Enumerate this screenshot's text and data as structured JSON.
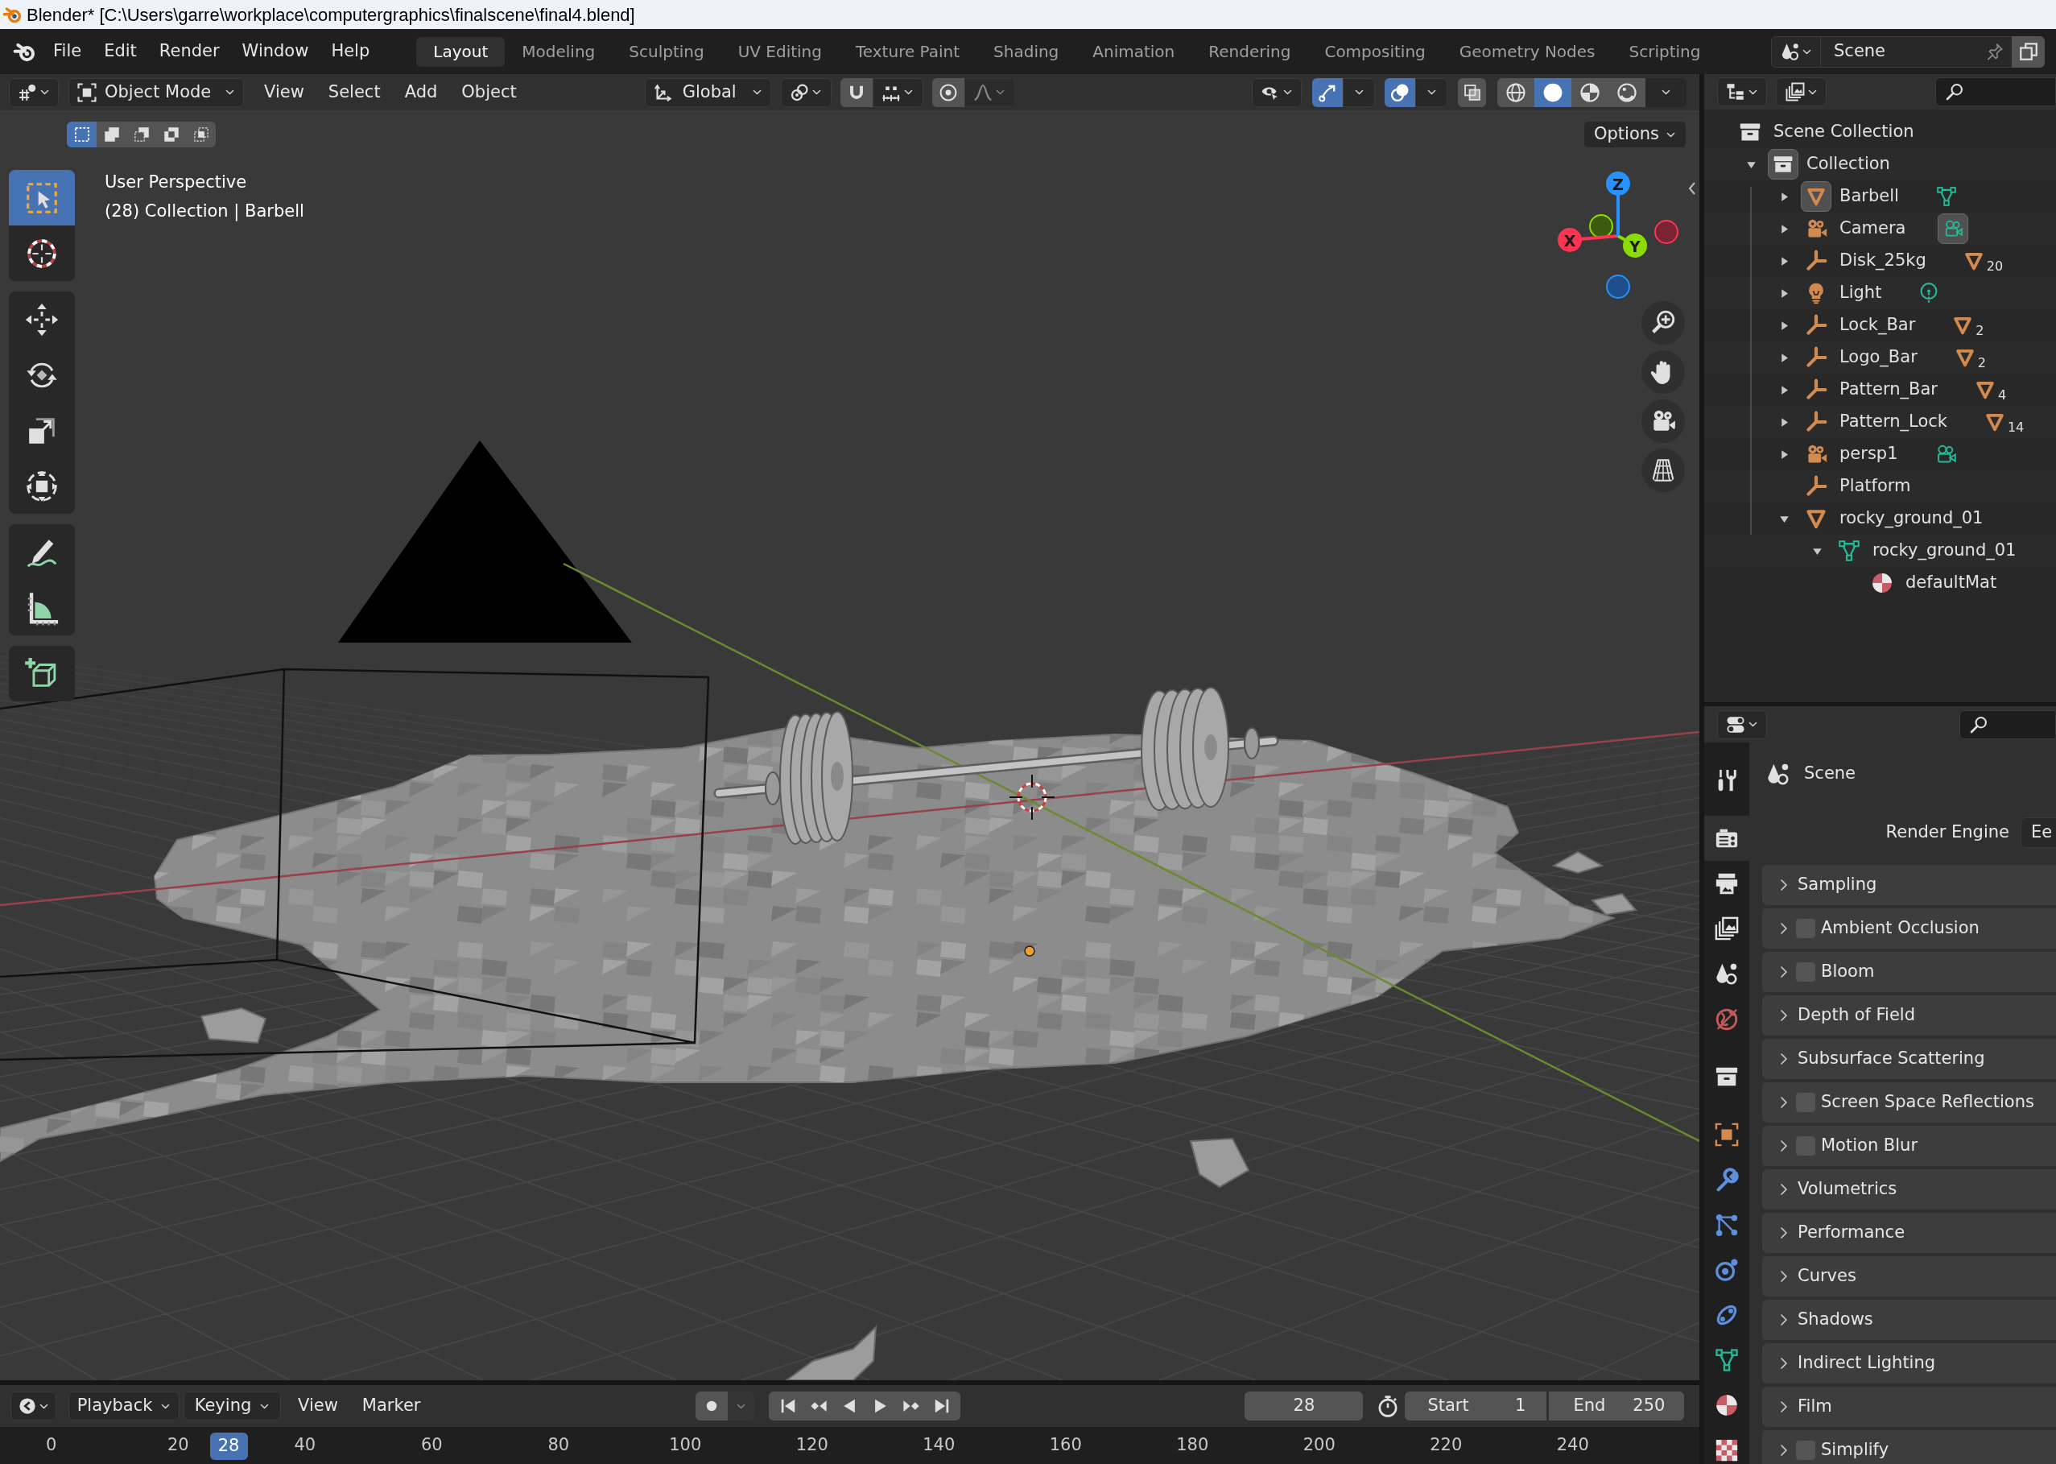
{
  "window": {
    "title": "Blender* [C:\\Users\\garre\\workplace\\computergraphics\\finalscene\\final4.blend]"
  },
  "top_bar": {
    "menus": [
      "File",
      "Edit",
      "Render",
      "Window",
      "Help"
    ],
    "workspaces": [
      {
        "label": "Layout",
        "selected": true
      },
      {
        "label": "Modeling",
        "selected": false
      },
      {
        "label": "Sculpting",
        "selected": false
      },
      {
        "label": "UV Editing",
        "selected": false
      },
      {
        "label": "Texture Paint",
        "selected": false
      },
      {
        "label": "Shading",
        "selected": false
      },
      {
        "label": "Animation",
        "selected": false
      },
      {
        "label": "Rendering",
        "selected": false
      },
      {
        "label": "Compositing",
        "selected": false
      },
      {
        "label": "Geometry Nodes",
        "selected": false
      },
      {
        "label": "Scripting",
        "selected": false
      }
    ],
    "scene": "Scene"
  },
  "viewport": {
    "mode": "Object Mode",
    "menus": [
      "View",
      "Select",
      "Add",
      "Object"
    ],
    "orientation": "Global",
    "snap": {
      "on": false
    },
    "proportional_editing": {
      "on": false
    },
    "gizmos": {
      "on": true
    },
    "overlays": {
      "on": true
    },
    "xray": {
      "on": false
    },
    "shading_modes": [
      {
        "selected": false
      },
      {
        "selected": true
      },
      {
        "selected": false
      },
      {
        "selected": false
      }
    ],
    "select_modes": [
      {
        "selected": true
      },
      {
        "selected": false
      },
      {
        "selected": false
      },
      {
        "selected": false
      },
      {
        "selected": false
      }
    ],
    "options": "Options",
    "tools": [
      {
        "selected": true
      },
      {
        "selected": false
      },
      {
        "selected": false
      },
      {
        "selected": false
      },
      {
        "selected": false
      },
      {
        "selected": false
      },
      {
        "selected": false
      },
      {
        "selected": false
      },
      {
        "selected": false
      }
    ],
    "view_name": "User Perspective",
    "context": "(28) Collection | Barbell",
    "gizmo_axes": [
      "X",
      "Y",
      "Z"
    ]
  },
  "outliner": {
    "tree": [
      {
        "name": "Scene Collection",
        "kind": "scene_collection",
        "children": [
          {
            "name": "Collection",
            "kind": "collection",
            "expanded": true,
            "active": true,
            "children": [
              {
                "name": "Barbell",
                "kind": "mesh",
                "expanded": false,
                "active": true,
                "badge": {
                  "kind": "mesh_data",
                  "active": false
                }
              },
              {
                "name": "Camera",
                "kind": "camera",
                "expanded": false,
                "active": false,
                "badge": {
                  "kind": "camera_data",
                  "active": true
                }
              },
              {
                "name": "Disk_25kg",
                "kind": "empty",
                "expanded": false,
                "active": false,
                "badge": {
                  "kind": "mesh",
                  "count": "20",
                  "active": false
                }
              },
              {
                "name": "Light",
                "kind": "light",
                "expanded": false,
                "active": false,
                "badge": {
                  "kind": "light_data",
                  "active": false
                }
              },
              {
                "name": "Lock_Bar",
                "kind": "empty",
                "expanded": false,
                "active": false,
                "badge": {
                  "kind": "mesh",
                  "count": "2",
                  "active": false
                }
              },
              {
                "name": "Logo_Bar",
                "kind": "empty",
                "expanded": false,
                "active": false,
                "badge": {
                  "kind": "mesh",
                  "count": "2",
                  "active": false
                }
              },
              {
                "name": "Pattern_Bar",
                "kind": "empty",
                "expanded": false,
                "active": false,
                "badge": {
                  "kind": "mesh",
                  "count": "4",
                  "active": false
                }
              },
              {
                "name": "Pattern_Lock",
                "kind": "empty",
                "expanded": false,
                "active": false,
                "badge": {
                  "kind": "mesh",
                  "count": "14",
                  "active": false
                }
              },
              {
                "name": "persp1",
                "kind": "camera",
                "expanded": false,
                "active": false,
                "badge": {
                  "kind": "camera_data",
                  "active": false
                }
              },
              {
                "name": "Platform",
                "kind": "empty",
                "active": false
              },
              {
                "name": "rocky_ground_01",
                "kind": "mesh",
                "expanded": true,
                "active": false,
                "children": [
                  {
                    "name": "rocky_ground_01",
                    "kind": "mesh_data",
                    "expanded": true,
                    "children": [
                      {
                        "name": "defaultMat",
                        "kind": "material"
                      }
                    ]
                  }
                ]
              }
            ]
          }
        ]
      }
    ]
  },
  "properties": {
    "tabs": [
      {
        "selected": false
      },
      {
        "selected": true
      },
      {
        "selected": false
      },
      {
        "selected": false
      },
      {
        "selected": false
      },
      {
        "selected": false
      },
      {
        "selected": false
      },
      {
        "selected": false
      },
      {
        "selected": false
      },
      {
        "selected": false
      },
      {
        "selected": false
      },
      {
        "selected": false
      },
      {
        "selected": false
      },
      {
        "selected": false
      },
      {
        "selected": false
      }
    ],
    "context": "Scene",
    "render_engine": {
      "label": "Render Engine",
      "value": "Ee"
    },
    "panels": [
      {
        "label": "Sampling",
        "kind": "plain",
        "expanded": false
      },
      {
        "label": "Ambient Occlusion",
        "kind": "toggle",
        "checked": false,
        "expanded": false
      },
      {
        "label": "Bloom",
        "kind": "toggle",
        "checked": false,
        "expanded": false
      },
      {
        "label": "Depth of Field",
        "kind": "plain",
        "expanded": false
      },
      {
        "label": "Subsurface Scattering",
        "kind": "plain",
        "expanded": false
      },
      {
        "label": "Screen Space Reflections",
        "kind": "toggle",
        "checked": false,
        "expanded": false
      },
      {
        "label": "Motion Blur",
        "kind": "toggle",
        "checked": false,
        "expanded": false
      },
      {
        "label": "Volumetrics",
        "kind": "plain",
        "expanded": false
      },
      {
        "label": "Performance",
        "kind": "plain",
        "expanded": false
      },
      {
        "label": "Curves",
        "kind": "plain",
        "expanded": false
      },
      {
        "label": "Shadows",
        "kind": "plain",
        "expanded": false
      },
      {
        "label": "Indirect Lighting",
        "kind": "plain",
        "expanded": false
      },
      {
        "label": "Film",
        "kind": "plain",
        "expanded": false
      },
      {
        "label": "Simplify",
        "kind": "toggle",
        "checked": false,
        "expanded": false
      }
    ]
  },
  "timeline": {
    "menus": [
      {
        "label": "Playback",
        "kind": "dropdown"
      },
      {
        "label": "Keying",
        "kind": "dropdown"
      },
      {
        "label": "View",
        "kind": "menu"
      },
      {
        "label": "Marker",
        "kind": "menu"
      }
    ],
    "auto_keying": {
      "on": false
    },
    "frame": "28",
    "start": {
      "label": "Start",
      "value": "1"
    },
    "end": {
      "label": "End",
      "value": "250"
    },
    "ruler": [
      "0",
      "20",
      "40",
      "60",
      "80",
      "100",
      "120",
      "140",
      "160",
      "180",
      "200",
      "220",
      "240"
    ],
    "current_frame": "28"
  }
}
